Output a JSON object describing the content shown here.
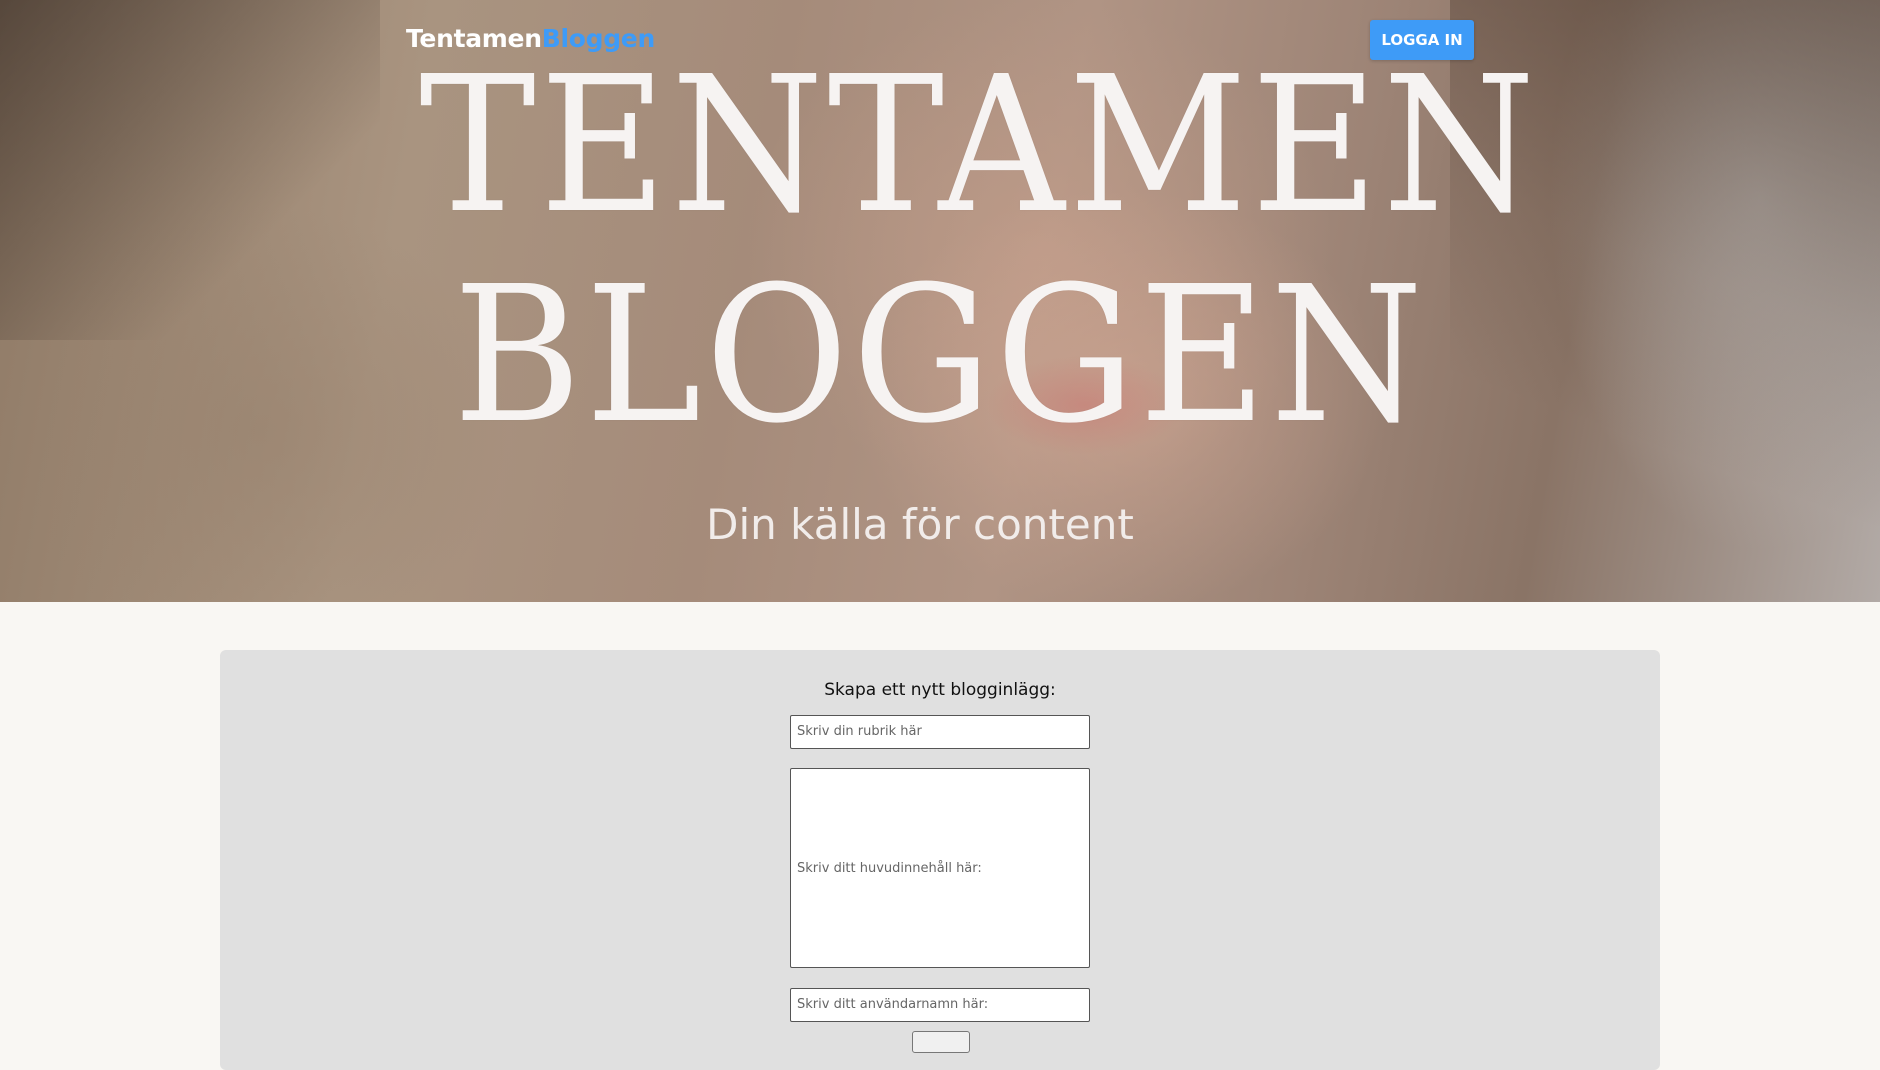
{
  "header": {
    "brand_part1": "Tentamen",
    "brand_part2": "Bloggen",
    "login_label": "LOGGA IN"
  },
  "hero": {
    "title_line1": "TENTAMEN",
    "title_line2": "BLOGGEN",
    "tagline": "Din källa för content"
  },
  "form": {
    "heading": "Skapa ett nytt blogginlägg:",
    "title_placeholder": "Skriv din rubrik här",
    "content_placeholder": "Skriv ditt huvudinnehåll här:",
    "username_placeholder": "Skriv ditt användarnamn här:"
  },
  "colors": {
    "accent": "#3e9bf7",
    "page_bg": "#f9f7f3",
    "card_bg": "#e0e0e0"
  }
}
